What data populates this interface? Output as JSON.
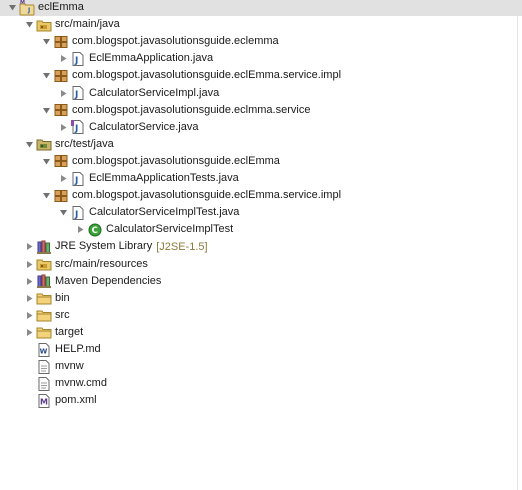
{
  "tree": [
    {
      "label": "eclEmma",
      "icon": "maven-java-project-icon",
      "toggle": "expanded",
      "depth": 0,
      "name": "project-root-eclemma",
      "selected": true
    },
    {
      "label": "src/main/java",
      "icon": "source-folder-icon",
      "toggle": "expanded",
      "depth": 1,
      "name": "folder-src-main-java"
    },
    {
      "label": "com.blogspot.javasolutionsguide.eclemma",
      "icon": "package-icon",
      "toggle": "expanded",
      "depth": 2,
      "name": "package-eclemma"
    },
    {
      "label": "EclEmmaApplication.java",
      "icon": "java-file-icon",
      "toggle": "collapsed",
      "depth": 3,
      "name": "file-eclemma-application"
    },
    {
      "label": "com.blogspot.javasolutionsguide.eclEmma.service.impl",
      "icon": "package-icon",
      "toggle": "expanded",
      "depth": 2,
      "name": "package-service-impl"
    },
    {
      "label": "CalculatorServiceImpl.java",
      "icon": "java-file-icon",
      "toggle": "collapsed",
      "depth": 3,
      "name": "file-calculator-service-impl"
    },
    {
      "label": "com.blogspot.javasolutionsguide.eclmma.service",
      "icon": "package-icon",
      "toggle": "expanded",
      "depth": 2,
      "name": "package-service"
    },
    {
      "label": "CalculatorService.java",
      "icon": "java-interface-file-icon",
      "toggle": "collapsed",
      "depth": 3,
      "name": "file-calculator-service"
    },
    {
      "label": "src/test/java",
      "icon": "test-source-folder-icon",
      "toggle": "expanded",
      "depth": 1,
      "name": "folder-src-test-java"
    },
    {
      "label": "com.blogspot.javasolutionsguide.eclEmma",
      "icon": "package-icon",
      "toggle": "expanded",
      "depth": 2,
      "name": "package-test-eclemma"
    },
    {
      "label": "EclEmmaApplicationTests.java",
      "icon": "java-file-icon",
      "toggle": "collapsed",
      "depth": 3,
      "name": "file-eclemma-application-tests"
    },
    {
      "label": "com.blogspot.javasolutionsguide.eclEmma.service.impl",
      "icon": "package-icon",
      "toggle": "expanded",
      "depth": 2,
      "name": "package-test-service-impl"
    },
    {
      "label": "CalculatorServiceImplTest.java",
      "icon": "java-file-icon",
      "toggle": "expanded",
      "depth": 3,
      "name": "file-calculator-service-impl-test"
    },
    {
      "label": "CalculatorServiceImplTest",
      "icon": "class-icon",
      "toggle": "collapsed",
      "depth": 4,
      "name": "class-calculator-service-impl-test"
    },
    {
      "label": "JRE System Library",
      "decoration": "[J2SE-1.5]",
      "icon": "library-icon",
      "toggle": "collapsed",
      "depth": 1,
      "name": "jre-system-library"
    },
    {
      "label": "src/main/resources",
      "icon": "source-folder-icon",
      "toggle": "collapsed",
      "depth": 1,
      "name": "folder-src-main-resources"
    },
    {
      "label": "Maven Dependencies",
      "icon": "library-icon",
      "toggle": "collapsed",
      "depth": 1,
      "name": "maven-dependencies"
    },
    {
      "label": "bin",
      "icon": "folder-icon",
      "toggle": "collapsed",
      "depth": 1,
      "name": "folder-bin"
    },
    {
      "label": "src",
      "icon": "folder-icon",
      "toggle": "collapsed",
      "depth": 1,
      "name": "folder-src"
    },
    {
      "label": "target",
      "icon": "folder-icon",
      "toggle": "collapsed",
      "depth": 1,
      "name": "folder-target"
    },
    {
      "label": "HELP.md",
      "icon": "markdown-file-icon",
      "toggle": "none",
      "depth": 1,
      "name": "file-help-md"
    },
    {
      "label": "mvnw",
      "icon": "text-file-icon",
      "toggle": "none",
      "depth": 1,
      "name": "file-mvnw"
    },
    {
      "label": "mvnw.cmd",
      "icon": "text-file-icon",
      "toggle": "none",
      "depth": 1,
      "name": "file-mvnw-cmd"
    },
    {
      "label": "pom.xml",
      "icon": "maven-pom-file-icon",
      "toggle": "none",
      "depth": 1,
      "name": "file-pom-xml"
    }
  ],
  "colors": {
    "selection": "#e1e1e1",
    "decoration": "#8a7a3a",
    "text": "#1a1a1a"
  }
}
